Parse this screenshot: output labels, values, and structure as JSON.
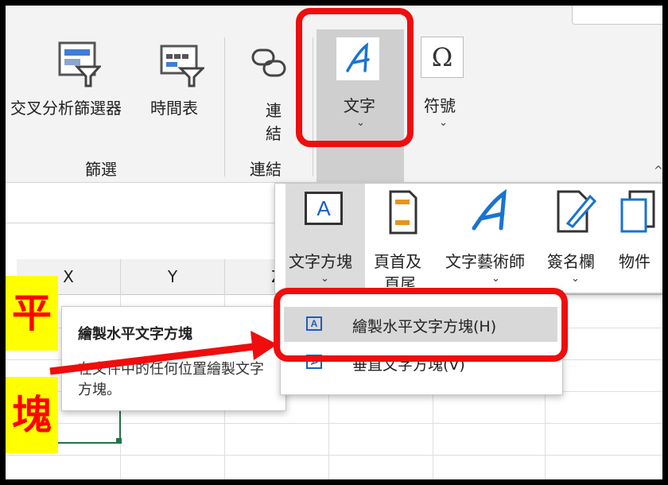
{
  "ribbon": {
    "pivot_slicer_label": "交叉分析篩選器",
    "timeline_label": "時間表",
    "filter_group_label": "篩選",
    "link_label_1": "連",
    "link_label_2": "結",
    "link_group_label": "連結",
    "text_label": "文字",
    "symbol_label": "符號"
  },
  "panel": {
    "textbox_label": "文字方塊",
    "header_footer_label_1": "頁首及",
    "header_footer_label_2": "頁尾",
    "wordart_label": "文字藝術師",
    "signature_label": "簽名欄",
    "object_label": "物件",
    "textbox_icon_text": "A"
  },
  "grid": {
    "columns": [
      "X",
      "Y",
      "Z"
    ]
  },
  "menu": {
    "items": [
      {
        "label": "繪製水平文字方塊(H)",
        "icon": "horizontal-textbox-icon",
        "icon_text": "A"
      },
      {
        "label": "垂直文字方塊(V)",
        "icon": "vertical-textbox-icon",
        "icon_text": "A"
      }
    ]
  },
  "tooltip": {
    "title": "繪製水平文字方塊",
    "description": "在文件中的任何位置繪製文字方塊。"
  },
  "overlay": {
    "char_1": "平",
    "char_2": "塊"
  },
  "colors": {
    "highlight_red": "#ef0d0d",
    "highlight_yellow": "#ffff00",
    "selection_green": "#217346"
  }
}
